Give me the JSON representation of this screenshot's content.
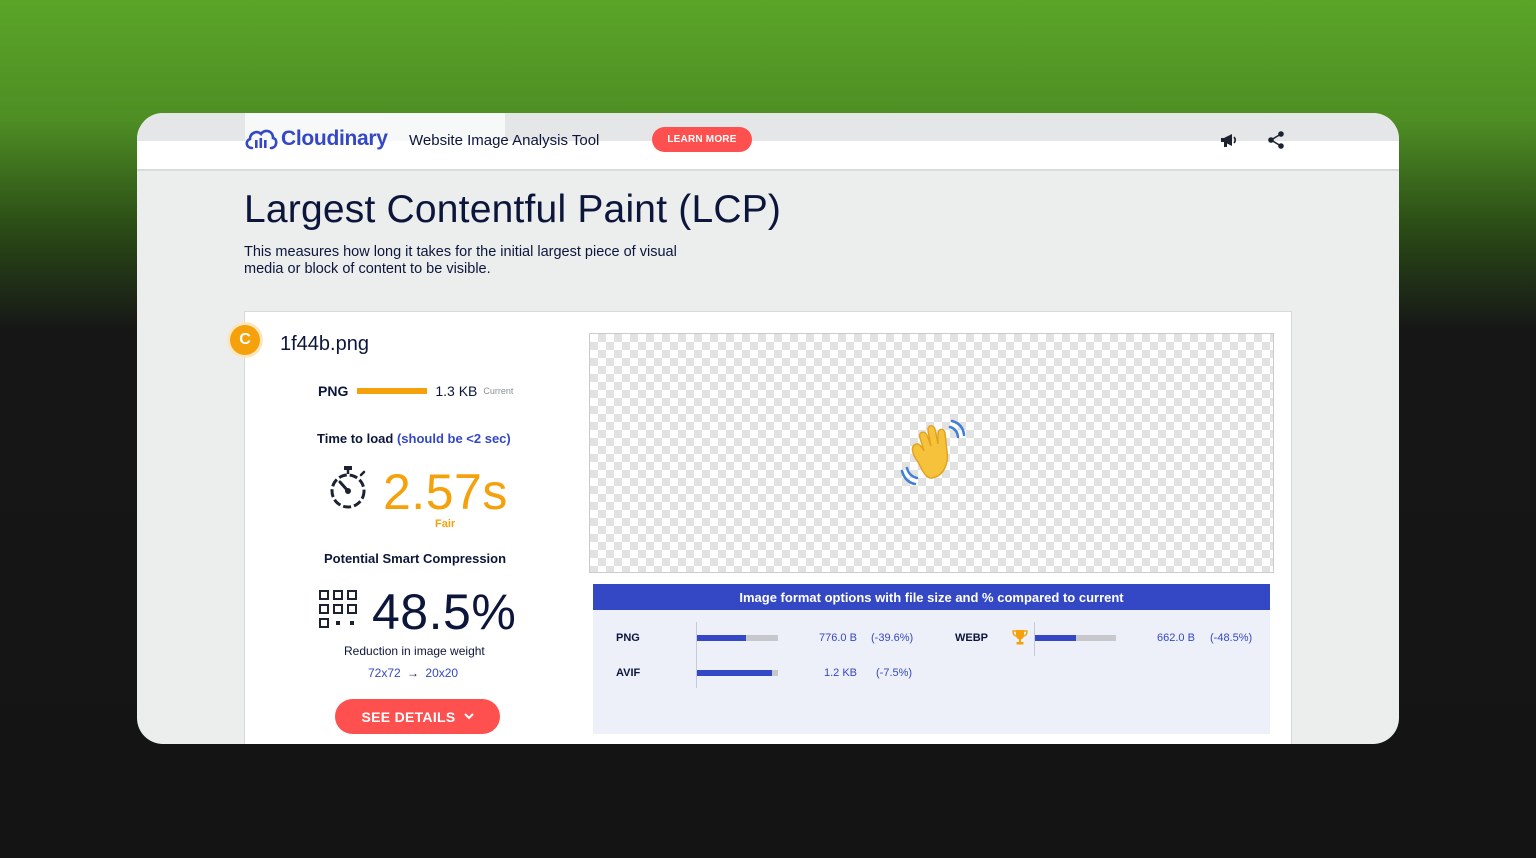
{
  "header": {
    "logo_text": "Cloudinary",
    "tool_title": "Website Image Analysis Tool",
    "learn_more": "LEARN MORE",
    "icons": [
      "megaphone-icon",
      "share-icon"
    ]
  },
  "page": {
    "title": "Largest Contentful Paint (LCP)",
    "description": "This measures how long it takes for the initial largest piece of visual media or block of content to be visible."
  },
  "image_card": {
    "badge": "C",
    "filename": "1f44b.png",
    "format": "PNG",
    "size": "1.3 KB",
    "size_note": "Current",
    "time_label": "Time to load",
    "time_hint": "(should be <2 sec)",
    "time_value": "2.57s",
    "time_rating": "Fair",
    "compression_label": "Potential Smart Compression",
    "compression_value": "48.5%",
    "reduction_label": "Reduction in image weight",
    "dims_from": "72x72",
    "dims_arrow": "→",
    "dims_to": "20x20",
    "see_details": "SEE DETAILS"
  },
  "formats": {
    "heading": "Image format options with file size and % compared to current",
    "options": [
      {
        "label": "PNG",
        "size": "776.0 B",
        "pct": "(-39.6%)",
        "fill": 0.6,
        "winner": false
      },
      {
        "label": "WEBP",
        "size": "662.0 B",
        "pct": "(-48.5%)",
        "fill": 0.51,
        "winner": true
      },
      {
        "label": "AVIF",
        "size": "1.2 KB",
        "pct": "(-7.5%)",
        "fill": 0.92,
        "winner": false
      }
    ]
  },
  "colors": {
    "brand_blue": "#3448c5",
    "accent_red": "#ff5050",
    "warning_orange": "#f5a10c",
    "navy_text": "#0c163b"
  }
}
